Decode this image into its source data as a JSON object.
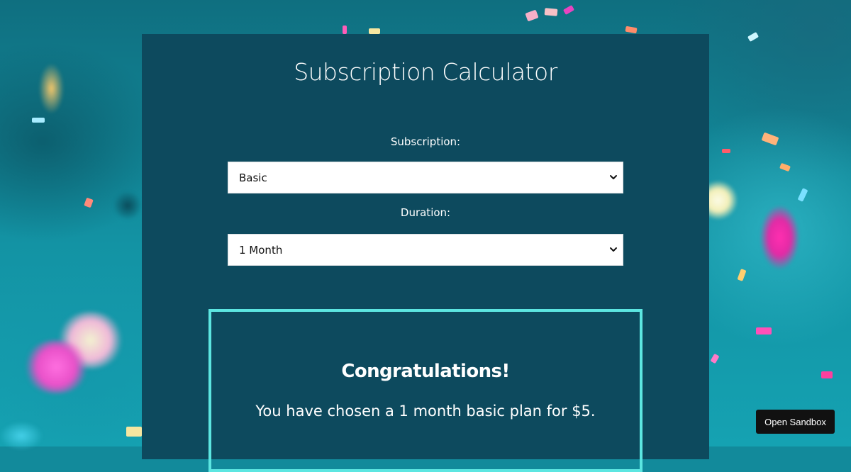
{
  "page": {
    "title": "Subscription Calculator",
    "background_color": "#128a9b",
    "panel_color": "#0d4a5e",
    "accent_color": "#5ce6e1"
  },
  "form": {
    "subscription": {
      "label": "Subscription:",
      "selected": "Basic",
      "icon": "chevron-down-icon"
    },
    "duration": {
      "label": "Duration:",
      "selected": "1 Month",
      "icon": "chevron-down-icon"
    }
  },
  "result": {
    "heading": "Congratulations!",
    "message": "You have chosen a 1 month basic plan for $5."
  },
  "sandbox": {
    "label": "Open Sandbox"
  }
}
